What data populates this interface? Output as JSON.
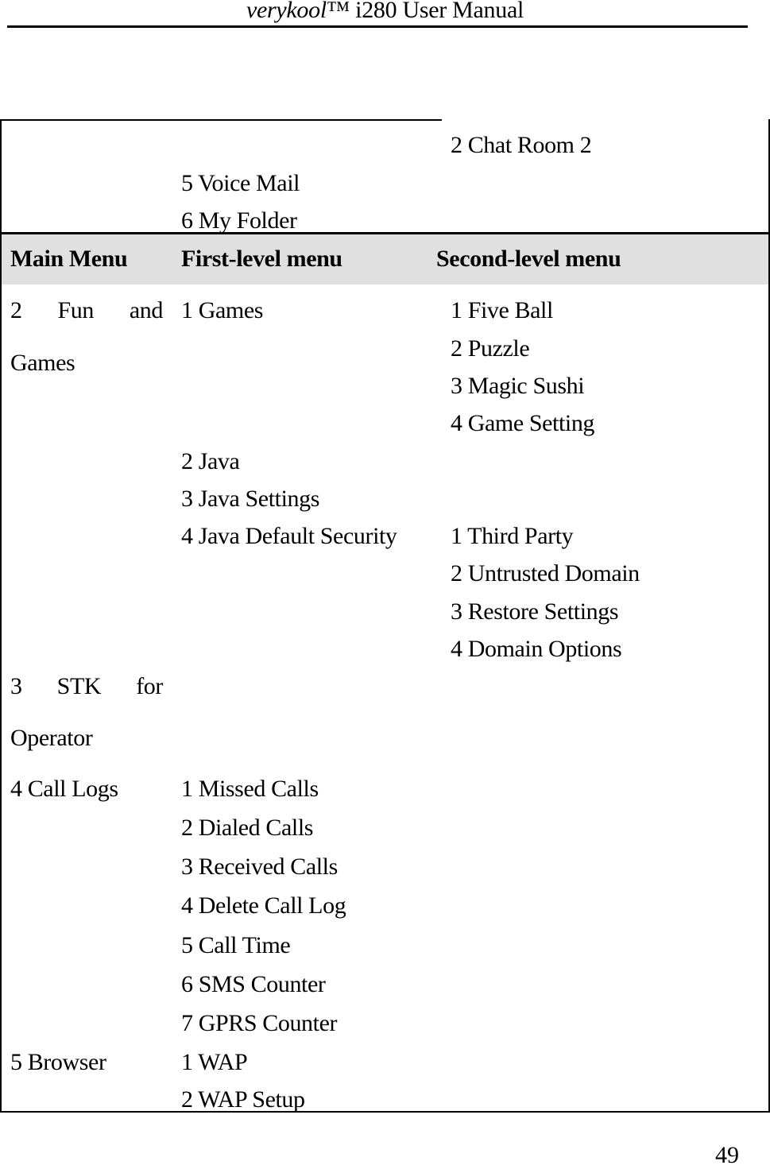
{
  "header": {
    "brand": "verykool",
    "trademark": "™",
    "title_rest": " i280 User Manual"
  },
  "continued_rows": {
    "second_level": [
      "2 Chat Room 2"
    ],
    "first_level": [
      "5 Voice Mail",
      "6 My Folder"
    ]
  },
  "table": {
    "columns": [
      "Main Menu",
      "First-level menu",
      "Second-level menu"
    ],
    "rows": {
      "fun_games": {
        "main_words": [
          "2",
          "Fun",
          "and"
        ],
        "main_line2": "Games",
        "games": "1 Games",
        "games_sub": [
          "1 Five Ball",
          "2 Puzzle",
          "3 Magic Sushi",
          "4 Game Setting"
        ],
        "java": "2 Java",
        "java_settings": "3 Java Settings",
        "java_security": "4 Java Default Security",
        "java_security_sub": [
          "1 Third Party",
          "2 Untrusted Domain",
          "3 Restore Settings",
          "4 Domain Options"
        ]
      },
      "stk": {
        "main_words": [
          "3",
          "STK",
          "for"
        ],
        "main_line2": "Operator"
      },
      "call_logs": {
        "main": "4 Call Logs",
        "first_level": [
          "1 Missed Calls",
          "2 Dialed Calls",
          "3 Received Calls",
          "4 Delete Call Log",
          "5 Call Time",
          "6 SMS Counter",
          "7 GPRS Counter"
        ]
      },
      "browser": {
        "main": "5 Browser",
        "first_level": [
          "1 WAP",
          "2 WAP Setup"
        ]
      }
    }
  },
  "footer": {
    "page_number": "49"
  }
}
